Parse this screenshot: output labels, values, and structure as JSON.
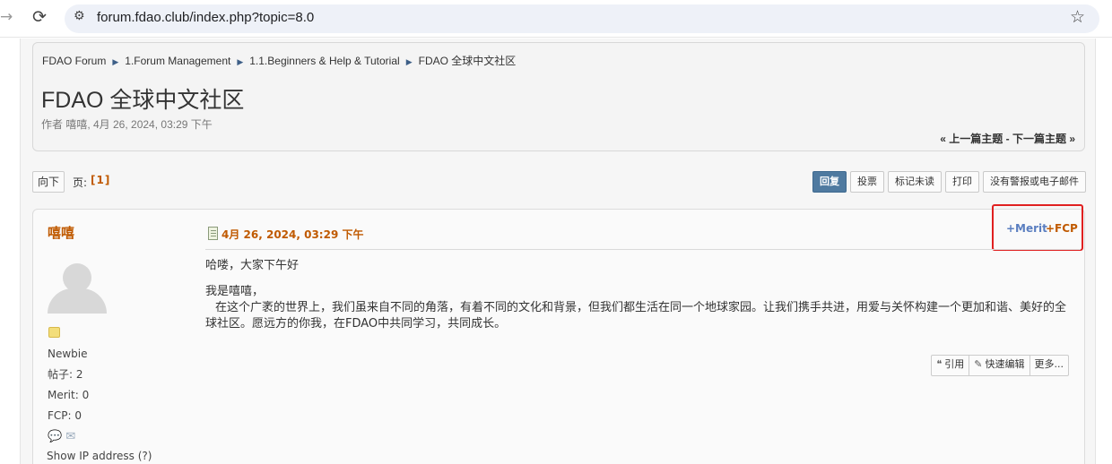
{
  "browser": {
    "url": "forum.fdao.club/index.php?topic=8.0"
  },
  "breadcrumb": [
    "FDAO Forum",
    "1.Forum Management",
    "1.1.Beginners & Help & Tutorial",
    "FDAO 全球中文社区"
  ],
  "topic": {
    "title": "FDAO 全球中文社区",
    "meta": "作者 嘻嘻, 4月 26, 2024, 03:29 下午",
    "prev_label": "« 上一篇主题",
    "next_label": "下一篇主题 »"
  },
  "paging": {
    "go_down": "向下",
    "pages_label": "页:",
    "pages_current": "[1]"
  },
  "buttons": {
    "reply": "回复",
    "vote": "投票",
    "mark_unread": "标记未读",
    "print": "打印",
    "notify": "没有警报或电子邮件"
  },
  "post": {
    "author": "嘻嘻",
    "rank": "Newbie",
    "posts": "帖子: 2",
    "merit": "Merit: 0",
    "fcp": "FCP: 0",
    "show_ip": "Show IP address (?)",
    "date": "4月 26, 2024, 03:29 下午",
    "merit_link": "+Merit",
    "fcp_link": "+FCP",
    "body": [
      "哈喽，大家下午好",
      "我是嘻嘻，",
      "在这个广袤的世界上，我们虽来自不同的角落，有着不同的文化和背景，但我们都生活在同一个地球家园。让我们携手共进，用爱与关怀构建一个更加和谐、美好的全球社区。愿远方的你我，在FDAO中共同学习，共同成长。"
    ],
    "quote": "引用",
    "quick_edit": "快速编辑",
    "more": "更多..."
  }
}
